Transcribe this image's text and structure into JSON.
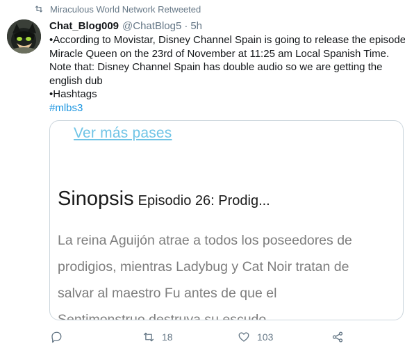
{
  "retweet_bar": {
    "icon": "retweet-icon",
    "text": "Miraculous World Network Retweeted"
  },
  "tweet": {
    "avatar": "avatar",
    "display_name": "Chat_Blog009",
    "handle": "@ChatBlog5",
    "separator": "·",
    "time": "5h",
    "lines": [
      "•According to Movistar, Disney Channel Spain is going to release the episode",
      "Miracle Queen on the 23rd of November at 11:25 am Local Spanish Time.",
      "Note that: Disney Channel Spain has double audio so we are getting the",
      "english dub",
      "•Hashtags"
    ],
    "hashtag": "#mlbs3"
  },
  "card": {
    "link_text": "Ver más pases",
    "title_big": "Sinopsis",
    "title_small": "Episodio 26: Prodig...",
    "synopsis_lines": [
      "La reina Aguijón atrae a todos los poseedores de",
      "prodigios, mientras Ladybug y Cat Noir tratan de",
      "salvar al maestro Fu antes de que el",
      "Sentimonstruo destruya su escudo."
    ]
  },
  "actions": {
    "reply": {
      "icon": "reply-icon"
    },
    "retweet": {
      "icon": "retweet-icon",
      "count": "18"
    },
    "like": {
      "icon": "heart-icon",
      "count": "103"
    },
    "share": {
      "icon": "share-icon"
    }
  },
  "colors": {
    "link": "#1b95e0",
    "muted": "#657786",
    "border": "#ccd6dd",
    "card_link": "#6fc4e6"
  }
}
